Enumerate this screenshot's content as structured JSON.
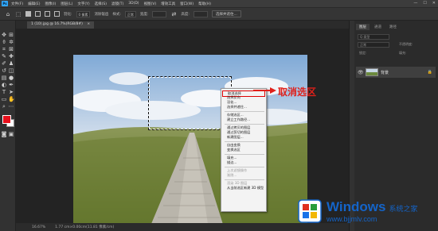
{
  "app": {
    "logo_text": "Ps",
    "menus": [
      "文件(F)",
      "编辑(E)",
      "图像(I)",
      "图层(L)",
      "文字(Y)",
      "选择(S)",
      "滤镜(T)",
      "3D(D)",
      "视图(V)",
      "增效工具",
      "窗口(W)",
      "帮助(H)"
    ],
    "window_controls": [
      "—",
      "☐",
      "✕"
    ]
  },
  "options_bar": {
    "feather_label": "羽化:",
    "feather_value": "0 像素",
    "antialias_label": "消除锯齿",
    "style_label": "样式:",
    "style_value": "正常",
    "width_label": "宽度:",
    "height_label": "高度:",
    "select_mask_button": "选择并遮住..."
  },
  "document": {
    "tab_title": "1 (10).jpg @ 16.7%(RGB/8#)",
    "tab_close": "×",
    "zoom": "16.67%",
    "doc_info": "1.77 cm×0.00cm(11.81 像素/cm)"
  },
  "panels": {
    "tabs": [
      "图层",
      "通道",
      "路径"
    ],
    "kind_label": "Q 类型",
    "blend_label": "正常",
    "opacity_label": "不透明度:",
    "lock_label": "锁定:",
    "fill_label": "填充:",
    "layer_name": "背景"
  },
  "context_menu": {
    "groups": [
      [
        "取消选择",
        "选择反向",
        "羽化...",
        "选择并遮住..."
      ],
      [
        "存储选区...",
        "建立工作路径..."
      ],
      [
        "通过拷贝的图层",
        "通过剪切的图层",
        "新建图层..."
      ],
      [
        "自由变换",
        "变换选区"
      ],
      [
        "填充...",
        "描边..."
      ],
      [
        "上次滤镜操作",
        "渐隐..."
      ],
      [
        "渲染 3D 图层",
        "从当前选区新建 3D 模型"
      ]
    ],
    "disabled": [
      "上次滤镜操作",
      "渐隐...",
      "渲染 3D 图层"
    ]
  },
  "annotation": {
    "text": "取消选区",
    "color": "#e0201a"
  },
  "watermark": {
    "title": "Windows",
    "subtitle": "系统之家",
    "url": "www.bjjmlv.com"
  },
  "colors": {
    "foreground": "#e8101c",
    "background": "#ffffff",
    "brand_blue": "#1464c8"
  }
}
